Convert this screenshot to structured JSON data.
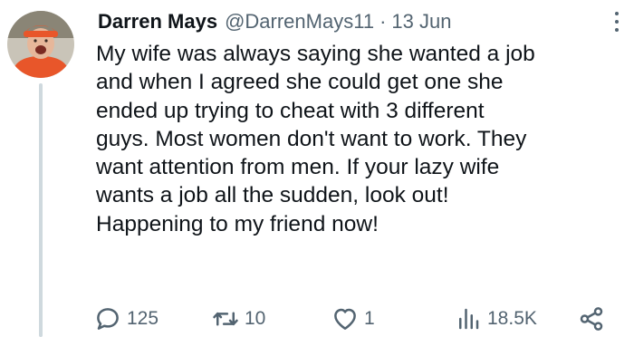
{
  "tweet": {
    "author_name": "Darren Mays",
    "handle": "@DarrenMays11",
    "separator": "·",
    "date": "13 Jun",
    "text_lines": [
      "My wife was always saying she wanted a job",
      "and when I agreed she could get one she",
      "ended up trying to cheat with 3 different",
      "guys. Most women don't want to work. They",
      "want attention from men. If your lazy wife",
      "wants a job all the sudden, look out!",
      "Happening to my friend now!"
    ]
  },
  "actions": {
    "replies": "125",
    "retweets": "10",
    "likes": "1",
    "views": "18.5K"
  },
  "icons": {
    "avatar": "avatar-photo",
    "more": "more-options-icon",
    "reply": "reply-icon",
    "retweet": "retweet-icon",
    "like": "heart-icon",
    "views": "views-icon",
    "share": "share-icon"
  },
  "colors": {
    "text": "#0f1419",
    "secondary": "#536471",
    "thread_line": "#cfd9de",
    "avatar_shirt": "#e8562a"
  }
}
